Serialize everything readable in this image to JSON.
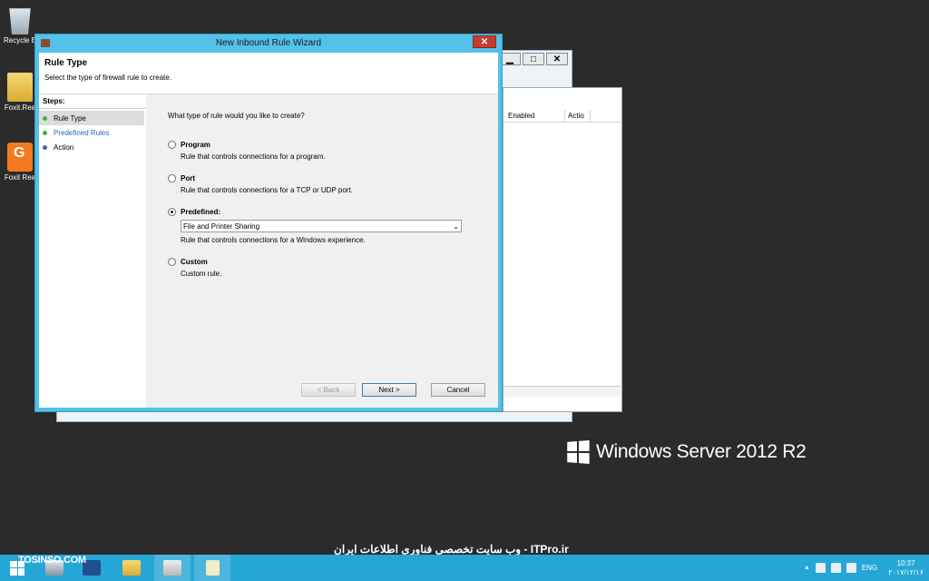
{
  "desktop": {
    "icons": [
      {
        "label": "Recycle B"
      },
      {
        "label": "Foxit.Rea"
      },
      {
        "label": "Foxit Rea"
      }
    ]
  },
  "bg_window": {
    "buttons": [
      "▁",
      "□",
      "✕"
    ],
    "columns": [
      "Enabled",
      "Actio"
    ]
  },
  "dialog": {
    "title": "New Inbound Rule Wizard",
    "close": "✕",
    "header_title": "Rule Type",
    "header_sub": "Select the type of firewall rule to create.",
    "steps_title": "Steps:",
    "steps": [
      {
        "label": "Rule Type",
        "color": "#3cb043"
      },
      {
        "label": "Predefined Rules",
        "color": "#3cb043"
      },
      {
        "label": "Action",
        "color": "#4a5fa8"
      }
    ],
    "question": "What type of rule would you like to create?",
    "options": [
      {
        "label": "Program",
        "desc": "Rule that controls connections for a program.",
        "selected": false
      },
      {
        "label": "Port",
        "desc": "Rule that controls connections for a TCP or UDP port.",
        "selected": false
      },
      {
        "label": "Predefined:",
        "desc": "Rule that controls connections for a Windows experience.",
        "selected": true,
        "select_value": "File and Printer Sharing"
      },
      {
        "label": "Custom",
        "desc": "Custom rule.",
        "selected": false
      }
    ],
    "buttons": {
      "back": "< Back",
      "next": "Next >",
      "cancel": "Cancel"
    }
  },
  "branding": {
    "text": "Windows Server 2012 R2"
  },
  "watermark": "وب سایت تخصصی فناوری اطلاعات ایران - ITPro.ir",
  "tosinso": "TOSINSO.COM",
  "taskbar": {
    "tray_lang": "ENG",
    "time": "10:37",
    "date": "۲۰۱۷/۱۲/۱۶"
  }
}
